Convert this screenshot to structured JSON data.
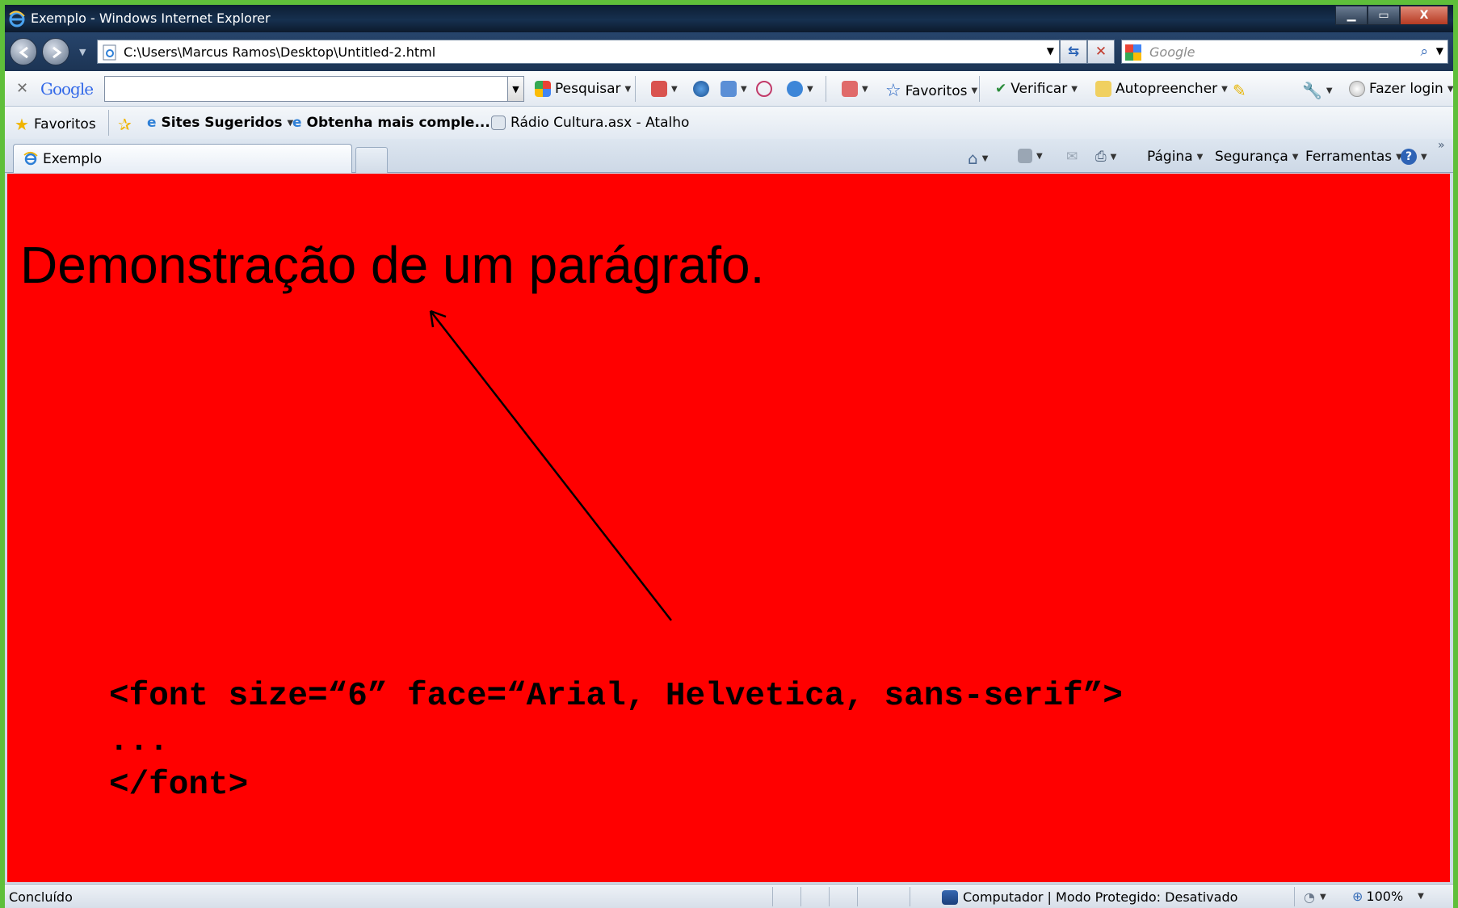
{
  "window": {
    "title": "Exemplo - Windows Internet Explorer",
    "controls": {
      "minimize": "▁",
      "maximize": "▭",
      "close": "X"
    }
  },
  "address": {
    "url": "C:\\Users\\Marcus Ramos\\Desktop\\Untitled-2.html",
    "search_placeholder": "Google"
  },
  "google_toolbar": {
    "logo": "Google",
    "pesquisar": "Pesquisar",
    "favoritos": "Favoritos",
    "verificar": "Verificar",
    "autopreencher": "Autopreencher",
    "fazer_login": "Fazer login"
  },
  "favorites_bar": {
    "favoritos": "Favoritos",
    "sites_sugeridos": "Sites Sugeridos",
    "obtenha": "Obtenha mais comple...",
    "radio": "Rádio Cultura.asx - Atalho"
  },
  "tab": {
    "label": "Exemplo"
  },
  "command_bar": {
    "pagina": "Página",
    "seguranca": "Segurança",
    "ferramentas": "Ferramentas"
  },
  "content": {
    "paragraph": "Demonstração de um parágrafo.",
    "code_lines": [
      "<font size=“6” face=“Arial, Helvetica, sans-serif”>",
      "...",
      "</font>"
    ]
  },
  "status": {
    "left": "Concluído",
    "zone": "Computador | Modo Protegido: Desativado",
    "zoom": "100%"
  }
}
